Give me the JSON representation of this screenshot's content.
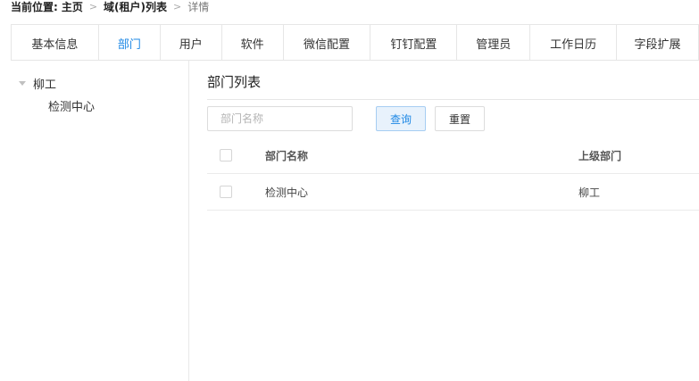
{
  "breadcrumb": {
    "label": "当前位置:",
    "items": [
      "主页",
      "域(租户)列表",
      "详情"
    ]
  },
  "tabs": [
    {
      "label": "基本信息",
      "active": false
    },
    {
      "label": "部门",
      "active": true
    },
    {
      "label": "用户",
      "active": false
    },
    {
      "label": "软件",
      "active": false
    },
    {
      "label": "微信配置",
      "active": false
    },
    {
      "label": "钉钉配置",
      "active": false
    },
    {
      "label": "管理员",
      "active": false
    },
    {
      "label": "工作日历",
      "active": false
    },
    {
      "label": "字段扩展",
      "active": false
    }
  ],
  "tree": {
    "root": {
      "label": "柳工",
      "expanded": true
    },
    "children": [
      {
        "label": "检测中心"
      }
    ]
  },
  "main": {
    "title": "部门列表",
    "search": {
      "placeholder": "部门名称",
      "value": ""
    },
    "query_label": "查询",
    "reset_label": "重置"
  },
  "table": {
    "columns": [
      "部门名称",
      "上级部门"
    ],
    "rows": [
      {
        "name": "检测中心",
        "parent": "柳工",
        "checked": false
      }
    ]
  },
  "colors": {
    "accent": "#1e88e5",
    "border": "#e6e6e6"
  }
}
